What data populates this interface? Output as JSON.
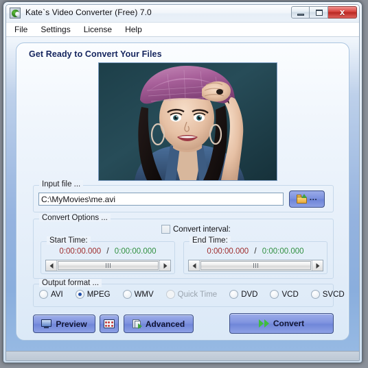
{
  "window": {
    "title": "Kate`s Video Converter (Free) 7.0",
    "app_icon": "app-logo-icon",
    "minimize_label": "",
    "maximize_label": "",
    "close_label": "x"
  },
  "menubar": {
    "items": [
      {
        "label": "File"
      },
      {
        "label": "Settings"
      },
      {
        "label": "License"
      },
      {
        "label": "Help"
      }
    ]
  },
  "panel": {
    "headline": "Get Ready to Convert Your Files",
    "preview": {
      "alt": "preview-thumbnail-woman-with-pink-hat",
      "background_color": "#1e4048"
    }
  },
  "input_file": {
    "legend": "Input file ...",
    "value": "C:\\MyMovies\\me.avi",
    "placeholder": "",
    "browse_label": "...",
    "browse_icon": "folder-open-icon"
  },
  "convert_options": {
    "legend": "Convert Options ...",
    "interval_label": "Convert interval:",
    "interval_checked": false,
    "start": {
      "legend": "Start Time:",
      "current": "0:00:00.000",
      "separator": "/",
      "total": "0:00:00.000"
    },
    "end": {
      "legend": "End Time:",
      "current": "0:00:00.000",
      "separator": "/",
      "total": "0:00:00.000"
    }
  },
  "output_format": {
    "legend": "Output format ...",
    "selected": "MPEG",
    "options": [
      {
        "label": "AVI",
        "selected": false,
        "disabled": false
      },
      {
        "label": "MPEG",
        "selected": true,
        "disabled": false
      },
      {
        "label": "WMV",
        "selected": false,
        "disabled": false
      },
      {
        "label": "Quick Time",
        "selected": false,
        "disabled": true
      },
      {
        "label": "DVD",
        "selected": false,
        "disabled": false
      },
      {
        "label": "VCD",
        "selected": false,
        "disabled": false
      },
      {
        "label": "SVCD",
        "selected": false,
        "disabled": false
      }
    ]
  },
  "actions": {
    "preview_label": "Preview",
    "preview_icon": "monitor-icon",
    "grid_label": "",
    "grid_icon": "thumbnail-grid-icon",
    "advanced_label": "Advanced",
    "advanced_icon": "document-run-icon",
    "convert_label": "Convert",
    "convert_icon": "fast-forward-icon"
  },
  "colors": {
    "accent_button": "#7d92df",
    "time_current": "#9e2b2b",
    "time_total": "#2f8f3f",
    "headline": "#15255e",
    "close_button": "#c8352f"
  }
}
